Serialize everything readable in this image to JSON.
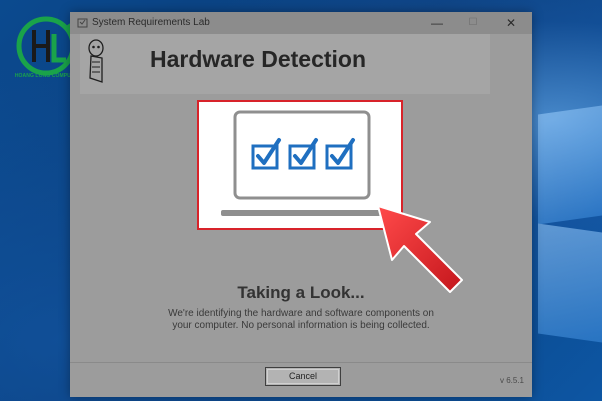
{
  "window": {
    "title": "System Requirements Lab",
    "minimize_glyph": "—",
    "maximize_glyph": "☐",
    "close_glyph": "✕"
  },
  "header": {
    "title": "Hardware Detection"
  },
  "main": {
    "heading": "Taking a Look...",
    "description_line1": "We're identifying the hardware and software components on",
    "description_line2": "your computer. No personal information is being collected."
  },
  "footer": {
    "cancel_label": "Cancel",
    "version": "v 6.5.1"
  },
  "brand": {
    "text": "HOANG LONG COMPUTER"
  },
  "colors": {
    "dialog_overlay": "#9c9c9c",
    "highlight_border": "#d8232a",
    "check_blue": "#1f6fc0",
    "arrow_red": "#e3232a",
    "brand_green": "#1aa34a",
    "desktop_blue": "#0b4a8f"
  },
  "icons": {
    "app": "srl-app-icon",
    "header": "srl-mascot-icon",
    "checks": [
      "checkbox-checked-icon",
      "checkbox-checked-icon",
      "checkbox-checked-icon"
    ],
    "pointer": "red-arrow-icon"
  }
}
